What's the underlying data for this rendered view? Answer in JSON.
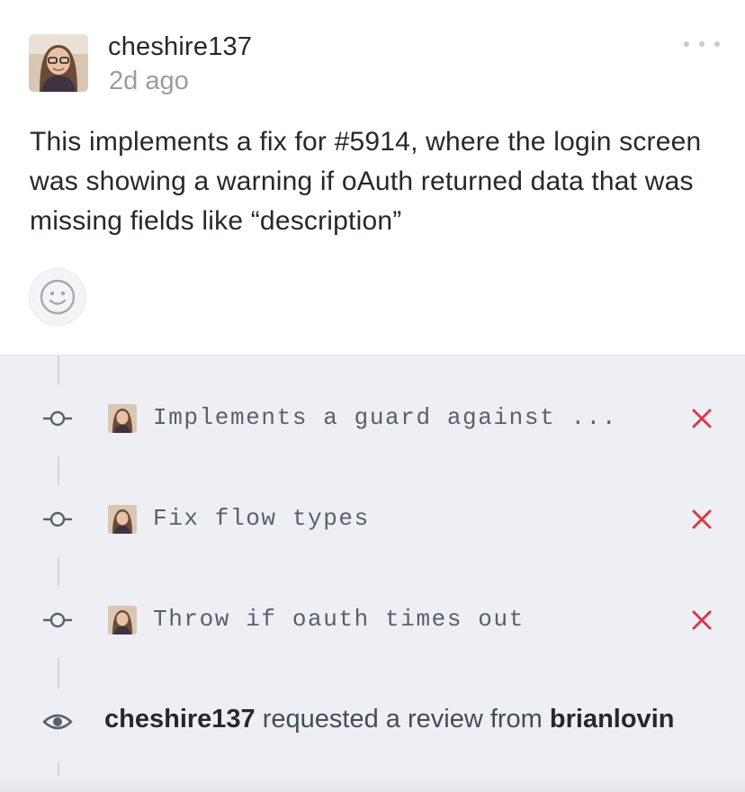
{
  "comment": {
    "author": "cheshire137",
    "timestamp": "2d ago",
    "body_before": "This implements a fix for ",
    "issue_ref": "#5914",
    "body_after": ", where the login screen was showing a warning if oAuth returned data that was missing fields like “description”",
    "more_icon": "more-horizontal-icon",
    "reaction_icon": "smiley-icon"
  },
  "timeline": {
    "commits": [
      {
        "message": "Implements a guard against ...",
        "status": "failure",
        "status_icon": "x-icon"
      },
      {
        "message": "Fix flow types",
        "status": "failure",
        "status_icon": "x-icon"
      },
      {
        "message": "Throw if oauth times out",
        "status": "failure",
        "status_icon": "x-icon"
      }
    ],
    "review_request": {
      "actor": "cheshire137",
      "action": "requested a review from",
      "reviewer": "brianlovin",
      "icon": "eye-icon"
    }
  },
  "colors": {
    "failure": "#d73a49",
    "timeline_bg": "#eeeff5",
    "muted_text": "#959da5"
  }
}
